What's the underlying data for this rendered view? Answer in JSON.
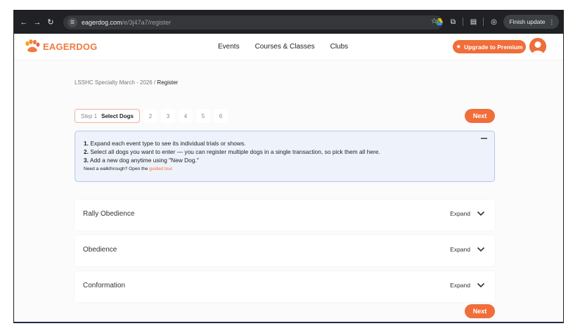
{
  "browser": {
    "url_host": "eagerdog.com",
    "url_path": "/e/3j47a7/register",
    "update_label": "Finish update"
  },
  "header": {
    "logo_eager": "EAGER",
    "logo_dog": "DOG",
    "nav": [
      "Events",
      "Courses & Classes",
      "Clubs"
    ],
    "upgrade_label": "Upgrade to Premium"
  },
  "breadcrumb": {
    "parent": "LSSHC Specialty March - 2026",
    "separator": "/",
    "current": "Register"
  },
  "stepper": {
    "active_num": "Step 1",
    "active_label": "Select Dogs",
    "steps": [
      "2",
      "3",
      "4",
      "5",
      "6"
    ]
  },
  "next_label": "Next",
  "info": {
    "line1_num": "1.",
    "line1": "Expand each event type to see its individual trials or shows.",
    "line2_num": "2.",
    "line2": "Select all dogs you want to enter — you can register multiple dogs in a single transaction, so pick them all here.",
    "line3_num": "3.",
    "line3": "Add a new dog anytime using \"New Dog.\"",
    "walkthrough_prefix": "Need a walkthrough? Open the",
    "walkthrough_link": "guided tour."
  },
  "sections": [
    {
      "title": "Rally Obedience",
      "action": "Expand"
    },
    {
      "title": "Obedience",
      "action": "Expand"
    },
    {
      "title": "Conformation",
      "action": "Expand"
    }
  ],
  "colors": {
    "accent": "#f06e3a",
    "info_bg": "#eef2fb",
    "info_border": "#b6c6ea"
  }
}
